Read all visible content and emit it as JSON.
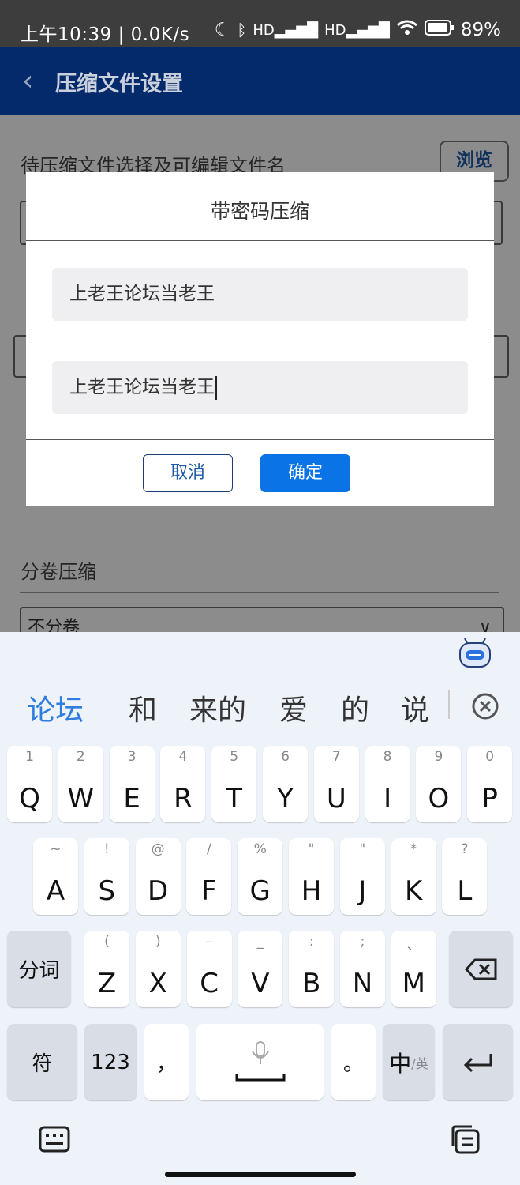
{
  "status_bar": {
    "time_speed": "上午10:39 | 0.0K/s",
    "battery": "89%",
    "signal_label_1": "HD",
    "signal_label_2": "HD"
  },
  "app_bar": {
    "title": "压缩文件设置"
  },
  "page": {
    "file_select_label": "待压缩文件选择及可编辑文件名",
    "browse_button": "浏览",
    "split_label": "分卷压缩",
    "split_select_value": "不分卷"
  },
  "dialog": {
    "title": "带密码压缩",
    "password_value": "上老王论坛当老王",
    "confirm_value": "上老王论坛当老王",
    "cancel_label": "取消",
    "ok_label": "确定"
  },
  "keyboard": {
    "candidates": [
      "论坛",
      "和",
      "来的",
      "爱",
      "的",
      "说"
    ],
    "row1": [
      {
        "hint": "1",
        "key": "Q"
      },
      {
        "hint": "2",
        "key": "W"
      },
      {
        "hint": "3",
        "key": "E"
      },
      {
        "hint": "4",
        "key": "R"
      },
      {
        "hint": "5",
        "key": "T"
      },
      {
        "hint": "6",
        "key": "Y"
      },
      {
        "hint": "7",
        "key": "U"
      },
      {
        "hint": "8",
        "key": "I"
      },
      {
        "hint": "9",
        "key": "O"
      },
      {
        "hint": "0",
        "key": "P"
      }
    ],
    "row2": [
      {
        "hint": "~",
        "key": "A"
      },
      {
        "hint": "!",
        "key": "S"
      },
      {
        "hint": "@",
        "key": "D"
      },
      {
        "hint": "/",
        "key": "F"
      },
      {
        "hint": "%",
        "key": "G"
      },
      {
        "hint": "\"",
        "key": "H"
      },
      {
        "hint": "\"",
        "key": "J"
      },
      {
        "hint": "*",
        "key": "K"
      },
      {
        "hint": "?",
        "key": "L"
      }
    ],
    "row3": [
      {
        "hint": "(",
        "key": "Z"
      },
      {
        "hint": ")",
        "key": "X"
      },
      {
        "hint": "–",
        "key": "C"
      },
      {
        "hint": "_",
        "key": "V"
      },
      {
        "hint": ":",
        "key": "B"
      },
      {
        "hint": ";",
        "key": "N"
      },
      {
        "hint": "、",
        "key": "M"
      }
    ],
    "segment_key": "分词",
    "symbol_key": "符",
    "number_key": "123",
    "comma_key": "，",
    "period_key": "。",
    "lang_key_main": "中",
    "lang_key_sub": "/英"
  }
}
